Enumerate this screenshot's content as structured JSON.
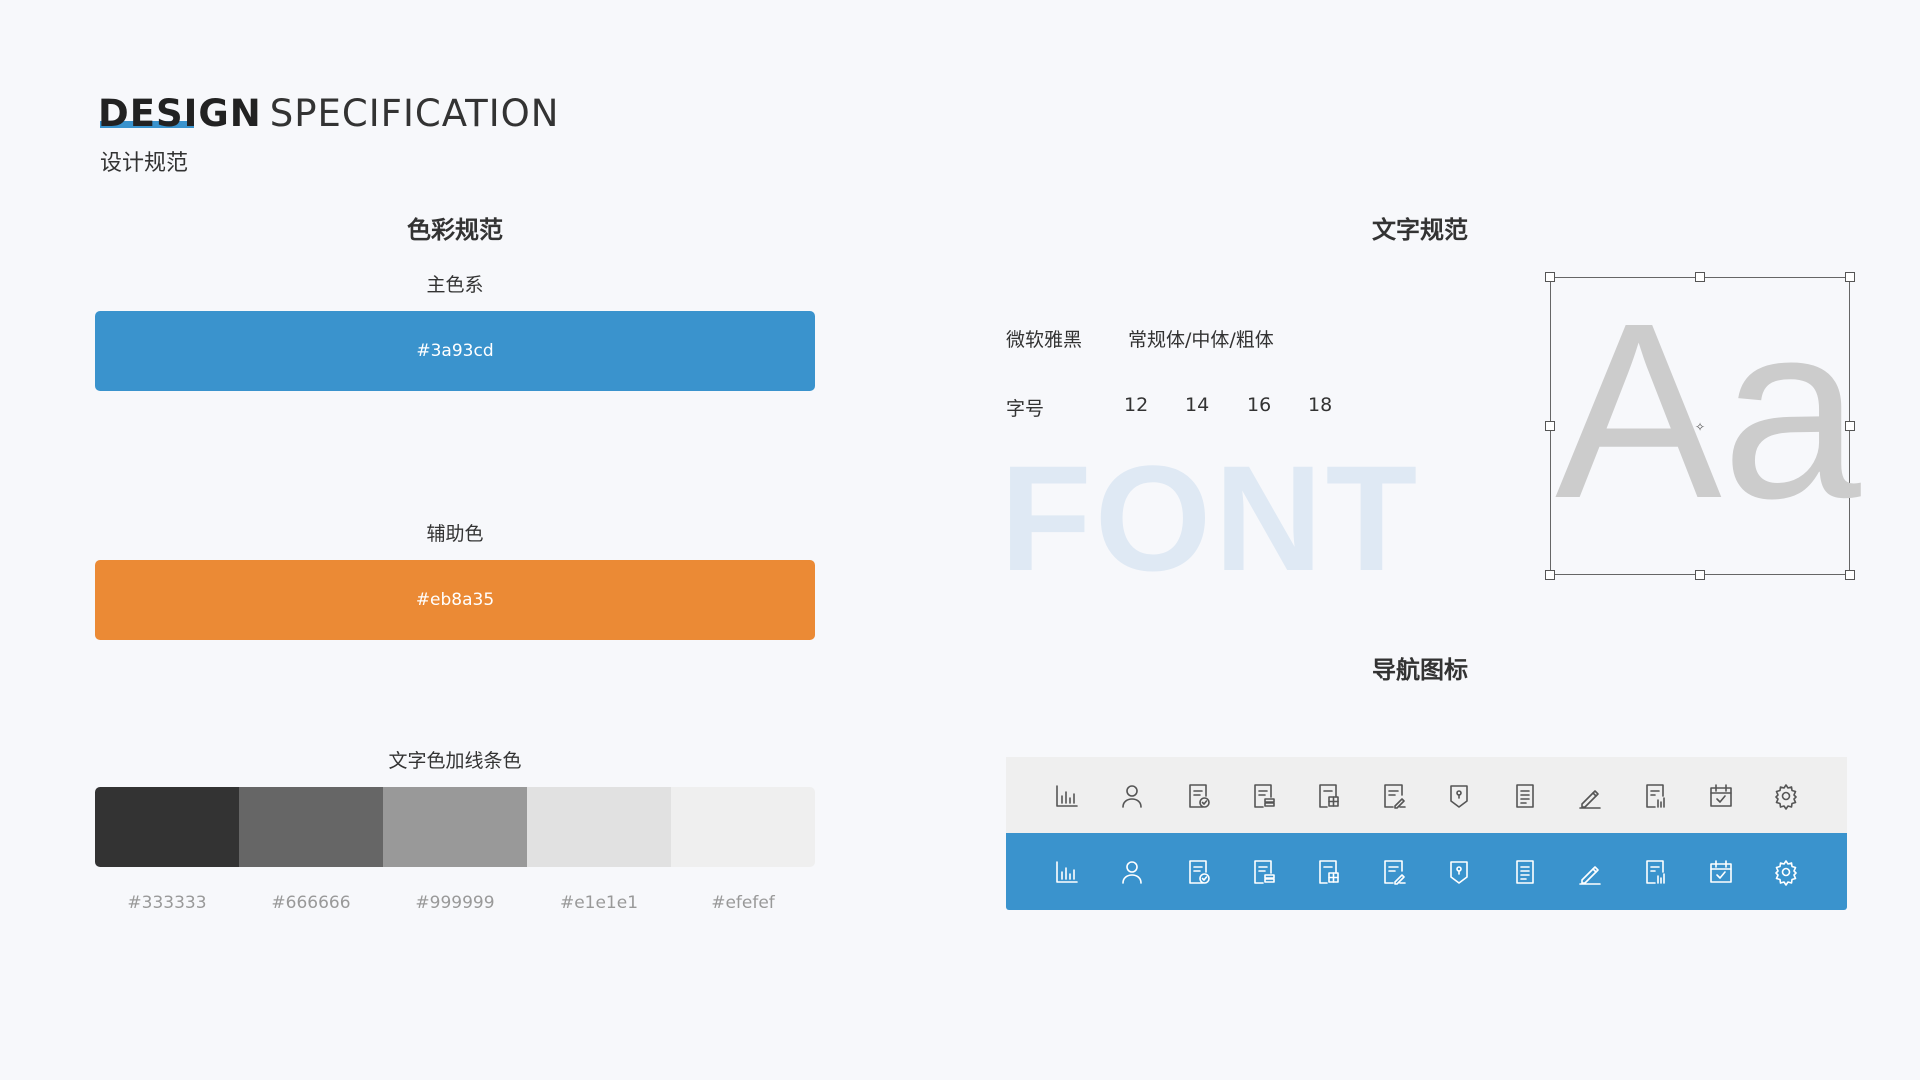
{
  "header": {
    "title_bold": "DESIGN",
    "title_light": "SPECIFICATION",
    "subtitle": "设计规范"
  },
  "color_spec": {
    "title": "色彩规范",
    "primary": {
      "label": "主色系",
      "hex": "#3a93cd"
    },
    "secondary": {
      "label": "辅助色",
      "hex": "#eb8a35"
    },
    "text_colors": {
      "label": "文字色加线条色",
      "swatches": [
        "#333333",
        "#666666",
        "#999999",
        "#e1e1e1",
        "#efefef"
      ]
    }
  },
  "text_spec": {
    "title": "文字规范",
    "font_name": "微软雅黑",
    "font_weights": "常规体/中体/粗体",
    "size_label": "字号",
    "sizes": [
      "12",
      "14",
      "16",
      "18"
    ],
    "watermark": "FONT",
    "sample": "Aa"
  },
  "nav_icons": {
    "title": "导航图标",
    "icons": [
      "bar-chart-icon",
      "user-icon",
      "document-check-icon",
      "document-stack-icon",
      "document-grid-icon",
      "document-edit-icon",
      "shield-icon",
      "document-list-icon",
      "pencil-icon",
      "document-chart-icon",
      "calendar-check-icon",
      "gear-icon"
    ]
  },
  "colors": {
    "primary": "#3a93cd",
    "secondary": "#eb8a35",
    "background": "#f7f8fb"
  }
}
